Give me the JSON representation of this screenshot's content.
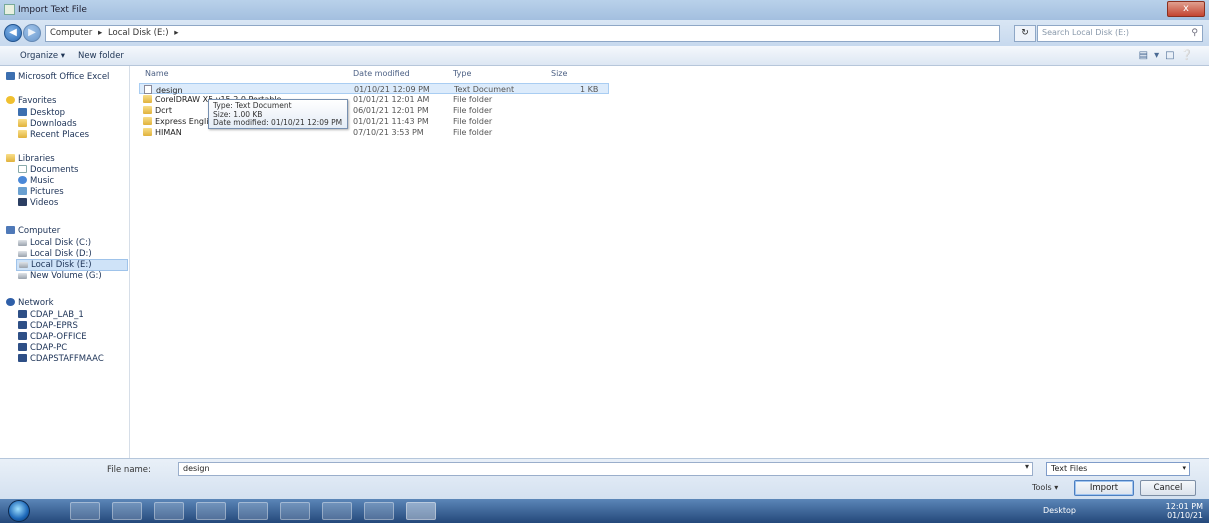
{
  "window": {
    "title": "Import Text File",
    "close": "x"
  },
  "addressbar": {
    "crumbs": [
      "Computer",
      "▸",
      "Local Disk (E:)",
      "▸"
    ],
    "search_placeholder": "Search Local Disk (E:)"
  },
  "toolbar": {
    "organize": "Organize ▾",
    "new_folder": "New folder"
  },
  "sidebar": {
    "top": "Microsoft Office Excel",
    "favorites": {
      "header": "Favorites",
      "items": [
        "Desktop",
        "Downloads",
        "Recent Places"
      ]
    },
    "libraries": {
      "header": "Libraries",
      "items": [
        "Documents",
        "Music",
        "Pictures",
        "Videos"
      ]
    },
    "computer": {
      "header": "Computer",
      "items": [
        "Local Disk (C:)",
        "Local Disk (D:)",
        "Local Disk (E:)",
        "New Volume (G:)"
      ]
    },
    "network": {
      "header": "Network",
      "items": [
        "CDAP_LAB_1",
        "CDAP-EPRS",
        "CDAP-OFFICE",
        "CDAP-PC",
        "CDAPSTAFFMAAC"
      ]
    }
  },
  "columns": {
    "name": "Name",
    "date": "Date modified",
    "type": "Type",
    "size": "Size"
  },
  "files": [
    {
      "name": "design",
      "date": "01/10/21 12:09 PM",
      "type": "Text Document",
      "size": "1 KB"
    },
    {
      "name": "CorelDRAW X5 v15.2.0 Portable",
      "date": "01/01/21 12:01 AM",
      "type": "File folder",
      "size": ""
    },
    {
      "name": "Dcrt",
      "date": "06/01/21 12:01 PM",
      "type": "File folder",
      "size": ""
    },
    {
      "name": "Express English",
      "date": "01/01/21 11:43 PM",
      "type": "File folder",
      "size": ""
    },
    {
      "name": "HIMAN",
      "date": "07/10/21 3:53 PM",
      "type": "File folder",
      "size": ""
    }
  ],
  "tooltip": {
    "type": "Type: Text Document",
    "size": "Size: 1.00 KB",
    "date": "Date modified: 01/10/21 12:09 PM"
  },
  "bottom": {
    "file_name_label": "File name:",
    "file_name_value": "design",
    "filter": "Text Files",
    "tools": "Tools ▾",
    "import": "Import",
    "cancel": "Cancel"
  },
  "taskbar": {
    "desktop": "Desktop",
    "time": "12:01 PM",
    "date": "01/10/21"
  }
}
